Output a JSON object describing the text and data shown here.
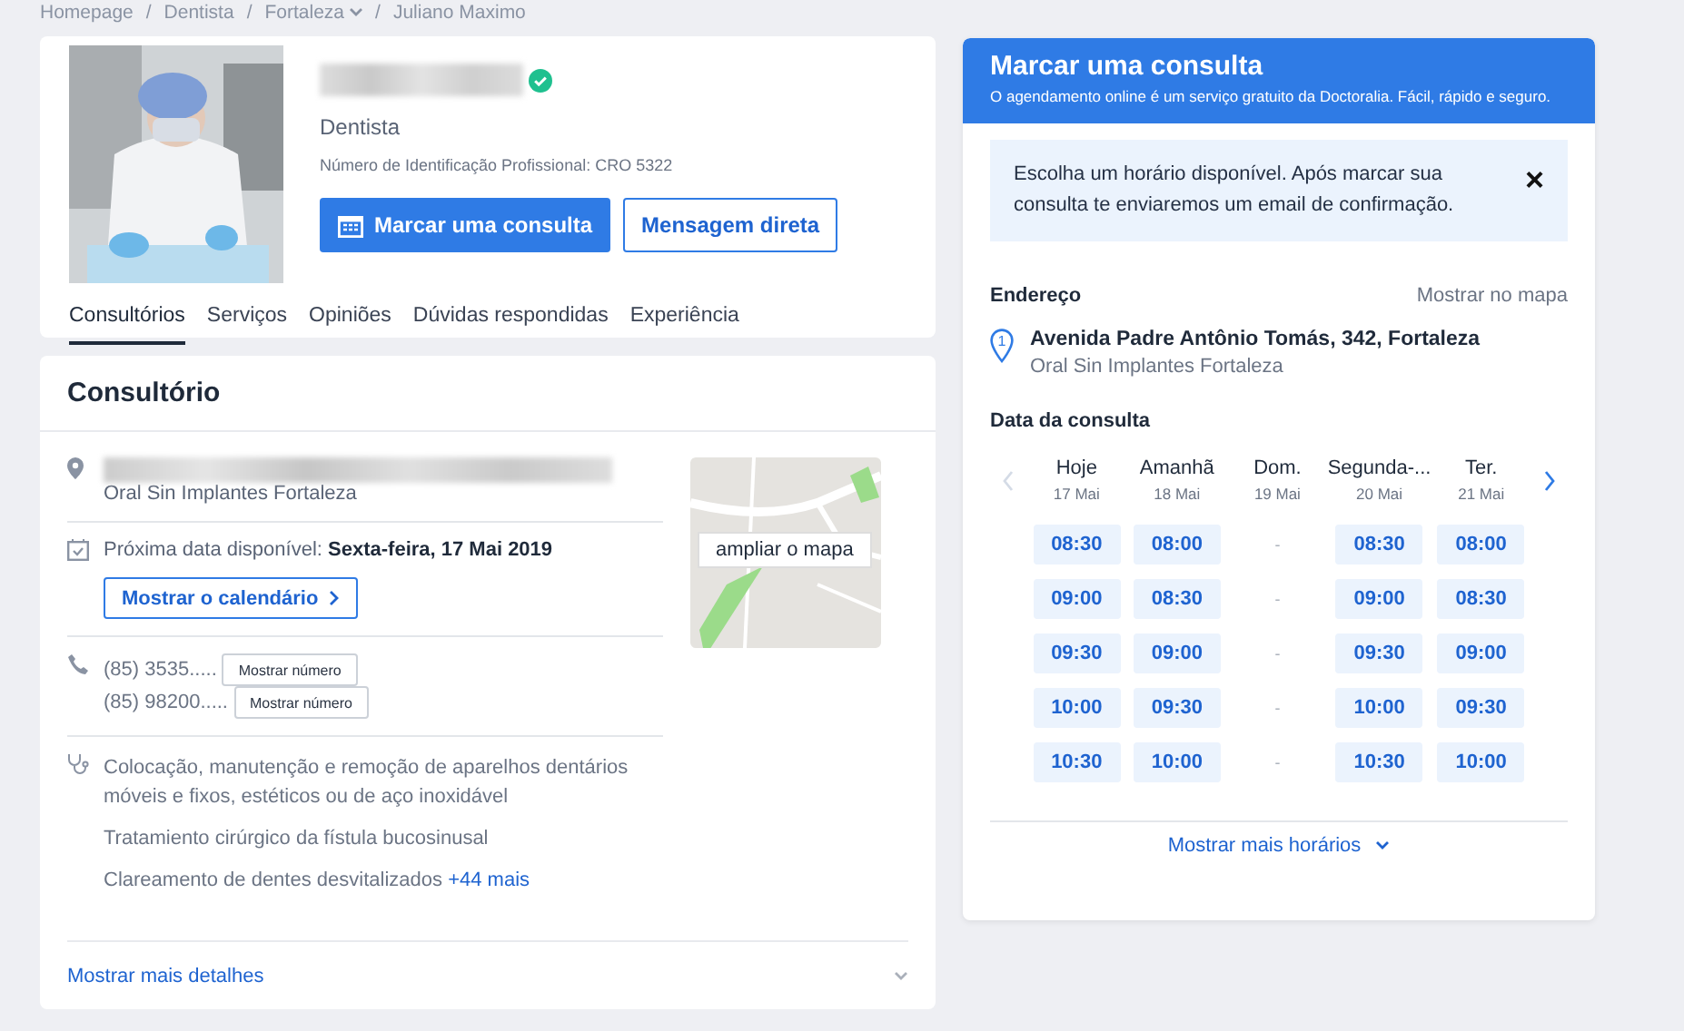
{
  "breadcrumb": [
    {
      "kind": "link",
      "label": "Homepage",
      "dropdown": false
    },
    {
      "kind": "separator",
      "label": "/"
    },
    {
      "kind": "link",
      "label": "Dentista",
      "dropdown": false
    },
    {
      "kind": "separator",
      "label": "/"
    },
    {
      "kind": "link",
      "label": "Fortaleza",
      "dropdown": true
    },
    {
      "kind": "separator",
      "label": "/"
    },
    {
      "kind": "link",
      "label": "Juliano Maximo",
      "dropdown": false
    }
  ],
  "profile": {
    "verified": true,
    "specialty": "Dentista",
    "license": "Número de Identificação Profissional: CRO 5322",
    "book_button": "Marcar uma consulta",
    "message_button": "Mensagem direta",
    "tabs": [
      {
        "label": "Consultórios",
        "selected": true
      },
      {
        "label": "Serviços",
        "selected": false
      },
      {
        "label": "Opiniões",
        "selected": false
      },
      {
        "label": "Dúvidas respondidas",
        "selected": false
      },
      {
        "label": "Experiência",
        "selected": false
      }
    ]
  },
  "office": {
    "title": "Consultório",
    "clinic": "Oral Sin Implantes Fortaleza",
    "next_label": "Próxima data disponível: **Sexta-feira, 17 Mai 2019**",
    "calendar_button": "Mostrar o calendário",
    "map_button": "ampliar o mapa",
    "phones": [
      {
        "number": "(85) 3535.....",
        "button": "Mostrar número"
      },
      {
        "number": "(85) 98200.....",
        "button": "Mostrar número"
      }
    ],
    "services": [
      "Colocação, manutenção e remoção de aparelhos dentários móveis e fixos, estéticos ou de aço inoxidável",
      "Tratamiento cirúrgico da fístula bucosinusal",
      "Clareamento de dentes desvitalizados"
    ],
    "more_services": "+44 mais",
    "more_details": "Mostrar mais detalhes"
  },
  "booking": {
    "title": "Marcar uma consulta",
    "subtitle": "O agendamento online é um serviço gratuito da Doctoralia. Fácil, rápido e seguro.",
    "notice": "Escolha um horário disponível. Após marcar sua consulta te enviaremos um email de confirmação.",
    "close": "×",
    "address_label": "Endereço",
    "map_link": "Mostrar no mapa",
    "pin_number": "1",
    "address": "Avenida Padre Antônio Tomás, 342, Fortaleza",
    "clinic": "Oral Sin Implantes Fortaleza",
    "date_label": "Data da consulta",
    "prev_enabled": false,
    "next_enabled": true,
    "days": [
      {
        "day": "Hoje",
        "date": "17 Mai",
        "available": true,
        "slots": [
          "08:30",
          "09:00",
          "09:30",
          "10:00",
          "10:30"
        ]
      },
      {
        "day": "Amanhã",
        "date": "18 Mai",
        "available": true,
        "slots": [
          "08:00",
          "08:30",
          "09:00",
          "09:30",
          "10:00"
        ]
      },
      {
        "day": "Dom.",
        "date": "19 Mai",
        "available": false,
        "slots": [
          "-",
          "-",
          "-",
          "-",
          "-"
        ]
      },
      {
        "day": "Segunda-...",
        "date": "20 Mai",
        "available": true,
        "slots": [
          "08:30",
          "09:00",
          "09:30",
          "10:00",
          "10:30"
        ]
      },
      {
        "day": "Ter.",
        "date": "21 Mai",
        "available": true,
        "slots": [
          "08:00",
          "08:30",
          "09:00",
          "09:30",
          "10:00"
        ]
      }
    ],
    "more_times": "Mostrar mais horários"
  }
}
